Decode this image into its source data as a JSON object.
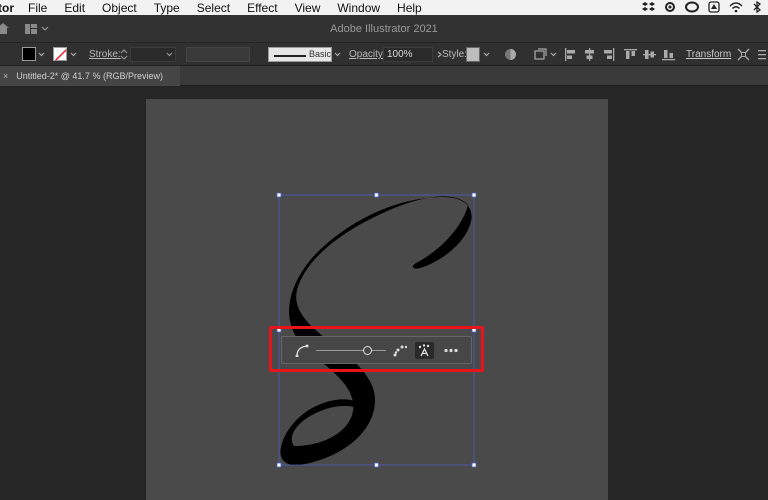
{
  "menubar": {
    "app": "tor",
    "items": [
      "File",
      "Edit",
      "Object",
      "Type",
      "Select",
      "Effect",
      "View",
      "Window",
      "Help"
    ]
  },
  "appbar": {
    "title": "Adobe Illustrator 2021"
  },
  "control": {
    "stroke_label": "Stroke:",
    "brush_label": "Basic",
    "opacity_label": "Opacity:",
    "opacity_value": "100%",
    "style_label": "Style:",
    "transform_label": "Transform"
  },
  "document_tab": {
    "title": "Untitled-2* @ 41.7 % (RGB/Preview)"
  },
  "colors": {
    "highlight": "#e8141c",
    "selection": "#4a5fc0",
    "glyph": "#000000"
  }
}
